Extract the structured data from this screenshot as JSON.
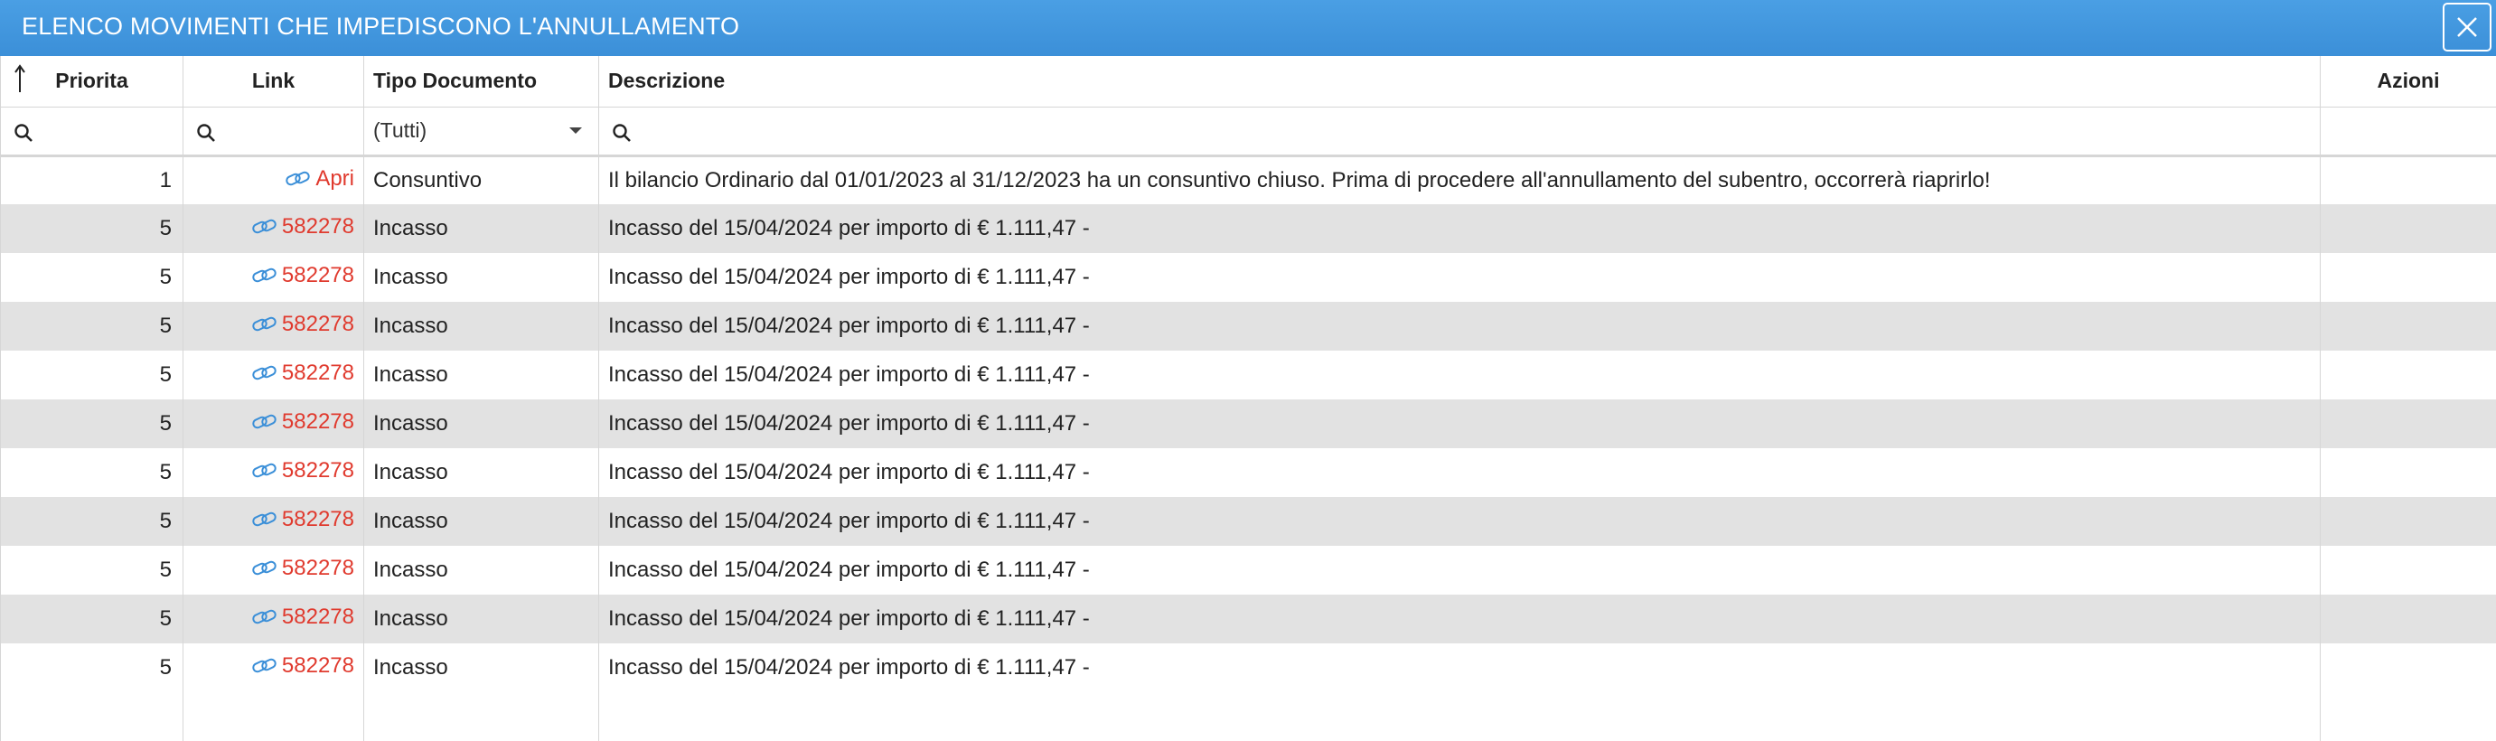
{
  "dialog": {
    "title": "ELENCO MOVIMENTI CHE IMPEDISCONO L'ANNULLAMENTO",
    "close_icon": "close-icon"
  },
  "columns": {
    "priorita": "Priorita",
    "link": "Link",
    "tipo_documento": "Tipo Documento",
    "descrizione": "Descrizione",
    "azioni": "Azioni"
  },
  "filters": {
    "tipo_documento_selected": "(Tutti)"
  },
  "rows": [
    {
      "priorita": "1",
      "link": "Apri",
      "tipo": "Consuntivo",
      "descrizione": "Il bilancio Ordinario dal 01/01/2023 al 31/12/2023 ha un consuntivo chiuso. Prima di procedere all'annullamento del subentro, occorrerà riaprirlo!"
    },
    {
      "priorita": "5",
      "link": "582278",
      "tipo": "Incasso",
      "descrizione": "Incasso del 15/04/2024 per importo di € 1.111,47 -"
    },
    {
      "priorita": "5",
      "link": "582278",
      "tipo": "Incasso",
      "descrizione": "Incasso del 15/04/2024 per importo di € 1.111,47 -"
    },
    {
      "priorita": "5",
      "link": "582278",
      "tipo": "Incasso",
      "descrizione": "Incasso del 15/04/2024 per importo di € 1.111,47 -"
    },
    {
      "priorita": "5",
      "link": "582278",
      "tipo": "Incasso",
      "descrizione": "Incasso del 15/04/2024 per importo di € 1.111,47 -"
    },
    {
      "priorita": "5",
      "link": "582278",
      "tipo": "Incasso",
      "descrizione": "Incasso del 15/04/2024 per importo di € 1.111,47 -"
    },
    {
      "priorita": "5",
      "link": "582278",
      "tipo": "Incasso",
      "descrizione": "Incasso del 15/04/2024 per importo di € 1.111,47 -"
    },
    {
      "priorita": "5",
      "link": "582278",
      "tipo": "Incasso",
      "descrizione": "Incasso del 15/04/2024 per importo di € 1.111,47 -"
    },
    {
      "priorita": "5",
      "link": "582278",
      "tipo": "Incasso",
      "descrizione": "Incasso del 15/04/2024 per importo di € 1.111,47 -"
    },
    {
      "priorita": "5",
      "link": "582278",
      "tipo": "Incasso",
      "descrizione": "Incasso del 15/04/2024 per importo di € 1.111,47 -"
    },
    {
      "priorita": "5",
      "link": "582278",
      "tipo": "Incasso",
      "descrizione": "Incasso del 15/04/2024 per importo di € 1.111,47 -"
    }
  ],
  "colors": {
    "header_blue": "#3b8fd8",
    "link_red": "#e03a2e",
    "link_icon_blue": "#3b8fd8",
    "stripe_gray": "#e2e2e2"
  }
}
